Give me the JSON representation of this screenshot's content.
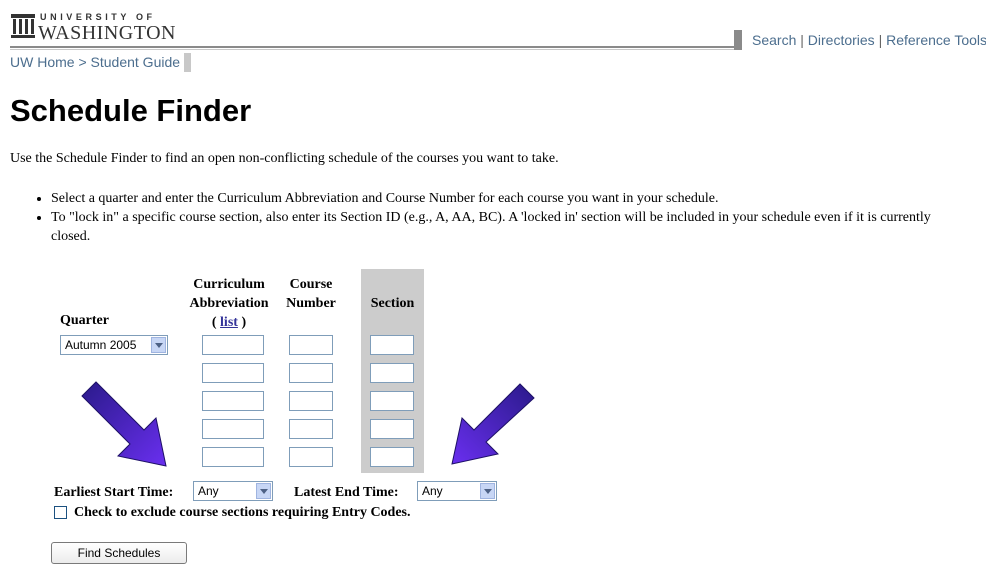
{
  "header": {
    "logo_top": "UNIVERSITY OF",
    "logo_main": "WASHINGTON",
    "links": [
      "Search",
      "Directories",
      "Reference Tools"
    ],
    "separator": "|"
  },
  "breadcrumb": {
    "home": "UW Home",
    "sep": ">",
    "current": "Student Guide"
  },
  "page": {
    "title": "Schedule Finder",
    "intro": "Use the Schedule Finder to find an open non-conflicting schedule of the courses you want to take.",
    "bullets": [
      "Select a quarter and enter the Curriculum Abbreviation and Course Number for each course you want in your schedule.",
      "To \"lock in\" a specific course section, also enter its Section ID (e.g., A, AA, BC). A 'locked in' section will be included in your schedule even if it is currently closed."
    ]
  },
  "form": {
    "quarter_label": "Quarter",
    "quarter_value": "Autumn 2005",
    "curriculum_header_1": "Curriculum",
    "curriculum_header_2": "Abbreviation",
    "list_open": "(",
    "list_link": "list",
    "list_close": ")",
    "course_header_1": "Course",
    "course_header_2": "Number",
    "section_header": "Section",
    "start_label": "Earliest Start Time:",
    "start_value": "Any",
    "end_label": "Latest End Time:",
    "end_value": "Any",
    "checkbox_label": "Check to exclude course sections requiring Entry Codes.",
    "checkbox_checked": false,
    "submit_label": "Find Schedules"
  },
  "colors": {
    "link": "#4c6e8e",
    "arrow": "#3a1fb0",
    "section_bg": "#cccccc"
  }
}
